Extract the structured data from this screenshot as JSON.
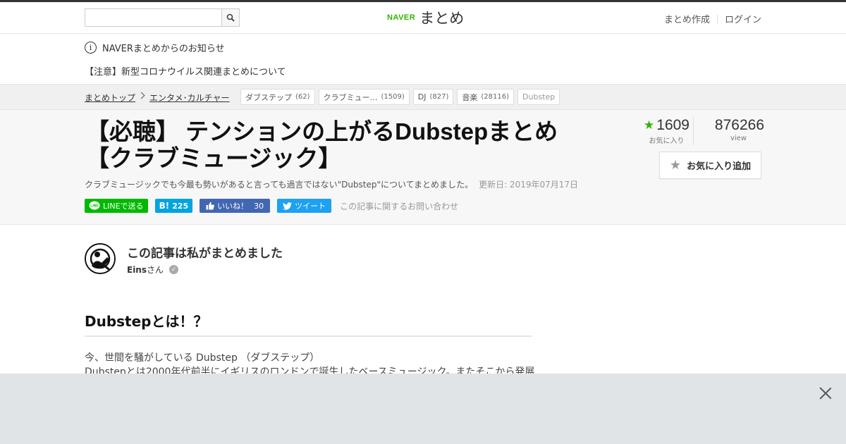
{
  "header": {
    "search_placeholder": "",
    "logo_brand": "NAVER",
    "logo_text": "まとめ",
    "links": [
      "まとめ作成",
      "ログイン"
    ]
  },
  "notice": {
    "title": "NAVERまとめからのお知らせ",
    "item": "【注意】新型コロナウイルス関連まとめについて"
  },
  "breadcrumb": {
    "items": [
      "まとめトップ",
      "エンタメ･カルチャー"
    ]
  },
  "tags": [
    {
      "label": "ダブステップ",
      "count": "(62)"
    },
    {
      "label": "クラブミュー…",
      "count": "(1509)"
    },
    {
      "label": "DJ",
      "count": "(827)"
    },
    {
      "label": "音楽",
      "count": "(28116)"
    },
    {
      "label": "Dubstep",
      "count": ""
    }
  ],
  "article": {
    "title_line1": "【必聴】 テンションの上がるDubstepまとめ",
    "title_line2": "【クラブミュージック】",
    "description": "クラブミュージックでも今最も勢いがあると言っても過言ではない\"Dubstep\"についてまとめました。",
    "updated": "更新日: 2019年07月17日"
  },
  "share": {
    "line_label": "LINEで送る",
    "hatena_icon": "B!",
    "hatena_count": "225",
    "fb_label": "いいね！",
    "fb_count": "30",
    "tweet_label": "ツイート",
    "contact": "この記事に関するお問い合わせ"
  },
  "stats": {
    "favorites": "1609",
    "favorites_label": "お気に入り",
    "views": "876266",
    "views_label": "view"
  },
  "fav_button": "お気に入り追加",
  "author": {
    "heading": "この記事は私がまとめました",
    "name": "Eins",
    "suffix": "さん"
  },
  "section": {
    "heading": "Dubstepとは！？",
    "line1": "今、世間を騒がしている Dubstep （ダブステップ）",
    "line2": "Dubstepとは2000年代前半にイギリスのロンドンで誕生したベースミュージック。またそこから発展"
  },
  "colors": {
    "brand_green": "#2db400",
    "line_green": "#00b900",
    "hatena_blue": "#00a4de",
    "facebook_blue": "#4267b2",
    "twitter_blue": "#1da1f2"
  }
}
